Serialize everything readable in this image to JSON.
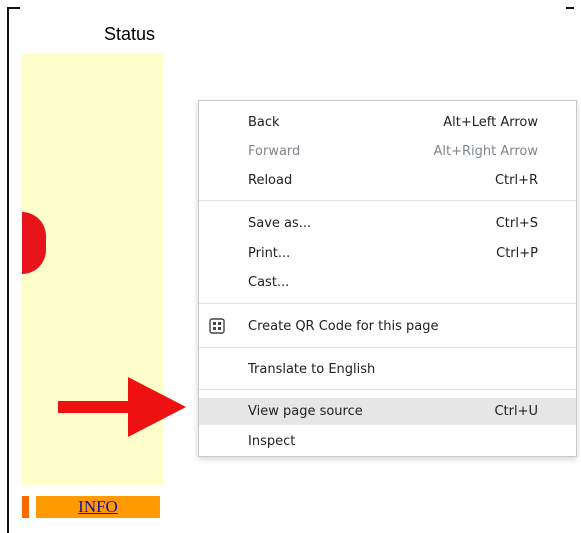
{
  "page": {
    "status_header": "Status",
    "info_link": "INFO"
  },
  "context_menu": {
    "items": [
      {
        "label": "Back",
        "shortcut": "Alt+Left Arrow",
        "enabled": true
      },
      {
        "label": "Forward",
        "shortcut": "Alt+Right Arrow",
        "enabled": false
      },
      {
        "label": "Reload",
        "shortcut": "Ctrl+R",
        "enabled": true
      },
      {
        "label": "Save as...",
        "shortcut": "Ctrl+S",
        "enabled": true
      },
      {
        "label": "Print...",
        "shortcut": "Ctrl+P",
        "enabled": true
      },
      {
        "label": "Cast...",
        "shortcut": "",
        "enabled": true
      },
      {
        "label": "Create QR Code for this page",
        "shortcut": "",
        "enabled": true,
        "icon": "qr-code-icon"
      },
      {
        "label": "Translate to English",
        "shortcut": "",
        "enabled": true
      },
      {
        "label": "View page source",
        "shortcut": "Ctrl+U",
        "enabled": true,
        "highlighted": true
      },
      {
        "label": "Inspect",
        "shortcut": "",
        "enabled": true
      }
    ]
  },
  "colors": {
    "panel": "#ffffcc",
    "accent_red": "#e8141b",
    "info_bar": "#ff9a00",
    "highlight": "#e6e6e6"
  }
}
